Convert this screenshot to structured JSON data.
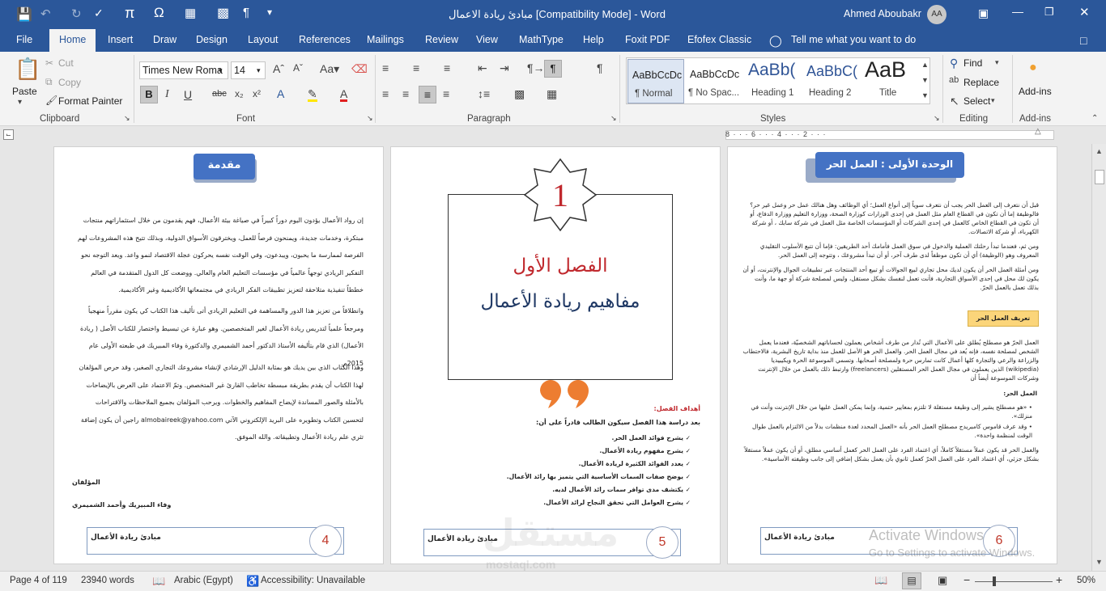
{
  "window": {
    "title": "مبادئ ريادة الاعمال [Compatibility Mode]  -  Word",
    "user": "Ahmed Aboubakr",
    "avatar": "AA"
  },
  "ribbon_tabs": [
    "File",
    "Home",
    "Insert",
    "Draw",
    "Design",
    "Layout",
    "References",
    "Mailings",
    "Review",
    "View",
    "MathType",
    "Help",
    "Foxit PDF",
    "Efofex Classic"
  ],
  "tell_me": "Tell me what you want to do",
  "clipboard": {
    "paste": "Paste",
    "cut": "Cut",
    "copy": "Copy",
    "format_painter": "Format Painter",
    "label": "Clipboard"
  },
  "font": {
    "name": "Times New Roma",
    "size": "14",
    "label": "Font"
  },
  "paragraph": {
    "label": "Paragraph"
  },
  "styles": {
    "items": [
      {
        "preview": "AaBbCcDc",
        "name": "¶ Normal"
      },
      {
        "preview": "AaBbCcDc",
        "name": "¶ No Spac..."
      },
      {
        "preview": "AaBb(",
        "name": "Heading 1"
      },
      {
        "preview": "AaBbC(",
        "name": "Heading 2"
      },
      {
        "preview": "AaB",
        "name": "Title"
      }
    ],
    "label": "Styles"
  },
  "editing": {
    "find": "Find",
    "replace": "Replace",
    "select": "Select",
    "label": "Editing"
  },
  "addins": {
    "button": "Add-ins",
    "label": "Add-ins"
  },
  "ruler": {
    "marks": "8 · · · 6 · · · 4 · · · 2 · · ·"
  },
  "pages": {
    "left": {
      "heading": "مقدمة",
      "paragraphs": [
        "إن رواد الأعمال يؤدون اليوم دوراً كبيراً في صياغة بيئة الأعمال، فهم يقدمون من خلال استثماراتهم منتجات مبتكرة، وخدمات جديدة، ويمنحون فرصاً للعمل، ويخترقون الأسواق الدولية، وبذلك تتيح هذه المشروعات لهم الفرصة لممارسة ما يحبون، ويبدعون، وفي الوقت نفسه يحركون عجلة الاقتصاد لنمو واعد. ويعد التوجه نحو التفكير الريادي توجهاً عالمياً في مؤسسات التعليم العام والعالي. ووضعت كل الدول المتقدمة في العالم خططاً تنفيذية متلاحقة لتعزيز تطبيقات الفكر الريادي في مجتمعاتها الأكاديمية وغير الأكاديمية.",
        "وانطلاقاً من تعزيز هذا الدور والمساهمة في التعليم الريادي أتى تأليف هذا الكتاب كي يكون مقرراً منهجياً ومرجعاً علمياً لتدريس ريادة الأعمال لغير المتخصصين. وهو عبارة عن تبسيط واختصار للكتاب الأصل ( ريادة الأعمال) الذي قام بتأليفه الأستاذ الدكتور أحمد الشميمري والدكتورة وفاء المبيريك في طبعته الأولى عام 2015م.",
        "وهذا الكتاب الذي بين يديك هو بمثابة الدليل الإرشادي لإنشاء مشروعك التجاري الصغير، وقد حرص المؤلفان لهذا الكتاب أن يقدم بطريقة مبسطة تخاطب القارئ غير المتخصص. وتمّ الاعتماد على العرض بالإيضاحات بالأمثلة والصور المساندة لإيضاح المفاهيم والخطوات. ويرحب المؤلفان بجميع الملاحظات والاقتراحات لتحسين الكتاب وتطويره على البريد الإلكتروني الآتي almobaireek@yahoo.com راجين أن يكون إضافة تثري علم ريادة الأعمال وتطبيقاته. والله الموفق."
      ],
      "authors_label": "المؤلفان",
      "authors": "وفاء المبيريك وأحمد الشميمري",
      "footer_title": "مبادئ ريادة الأعمال",
      "page_number": "4"
    },
    "middle": {
      "chapter_number": "1",
      "chapter_title": "الفصل الأول",
      "chapter_subtitle": "مفاهيم ريادة الأعمال",
      "goals_label": "أهداف الفصل:",
      "goals_intro": "بعد دراسة هذا الفصل سيكون الطالب قادراً على أن:",
      "goals": [
        "يشرح فوائد العمل الحر.",
        "يشرح مفهوم ريادة الأعمال.",
        "يعدد الفوائد الكثيرة لريادة الأعمال.",
        "يوضح صفات السمات الأساسية التي يتميز بها رائد الأعمال.",
        "يكتشف مدى توافر سمات رائد الأعمال لديه.",
        "يشرح العوامل التي تحقق النجاح لرائد الأعمال."
      ],
      "footer_title": "مبادئ ريادة الأعمال",
      "page_number": "5"
    },
    "right": {
      "heading": "الوحدة الأولى : العمل الحر",
      "paragraphs": [
        "قبل أن نتعرف إلى العمل الحر يجب أن نتعرف سوياً إلى أنواع العمل؛ أي الوظائف وهل هنالك عمل حر وعمل غير حر؟ فالوظيفة إما أن تكون في القطاع العام مثل العمل في إحدى الوزارات كوزارة الصحة، ووزارة التعليم ووزارة الدفاع، أو أن تكون في القطاع الخاص كالعمل في إحدى الشركات أو المؤسسات الخاصة مثل العمل في شركة سابك ، أو شركة الكهرباء، أو شركة الاتصالات.",
        "ومن ثم، فعندما تبدأ رحلتك العملية والدخول في سوق العمل فأمامك أحد الطريقين: فإما أن تتبع الأسلوب التقليدي المعروف وهو (الوظيفة) أي أن تكون موظفاً لدى طرف آخر، أو أن تبدأ مشروعك ، وتتوجه إلى العمل الحر.",
        "ومن أمثلة العمل الحر أن يكون لديك محل تجاري لبيع الجوالات أو تبيع أحد المنتجات عبر تطبيقات الجوال والإنترنت، أو أن يكون لك محل في إحدى الأسواق التجارية، فأنت تعمل لنفسك بشكل مستقل، وليس لمصلحة شركة أو جهة ما، وأنت بذلك تعمل بالعمل الحرّ."
      ],
      "box_label": "تعريف العمل الحر",
      "definition": "العمل الحرّ هو مصطلح يُطلق على الأعمال التي تُدار من طرف أشخاص يعملون لحساباتهم الشخصيّة، فعندما يعمل الشخص لمصلحة نفسه، فإنه يُعد في مجال العمل الحر. والعمل الحر هو الأصل للعمل منذ بداية تاريخ البشرية، فالاحتطاب والزراعة والرعي والتجارة كلها أعمال كانت تمارس حرة ولمصلحة أصحابها. وتسمي الموسوعة الحرة ويكيبيديا (wikipedia) الذين يعملون في مجال العمل الحر المستقلين (freelancers) وارتبط ذلك بالعمل من خلال الإنترنت وشركات الموسوعة أيضاً أن",
      "subhead": "العمل الحر:",
      "bullets": [
        "«هو مصطلح يشير إلى وظيفة مستقلة لا تلتزم بمعايير حتمية، وإنما يمكن العمل عليها من خلال الإنترنت وأنت في منزلك».",
        "وقد عرف قاموس كامبريدج مصطلح العمل الحر بأنه «العمل المحدد لعدة منظمات بدلاً من الالتزام بالعمل طوال الوقت لمنظمة واحدة»."
      ],
      "closing": "والعمل الحر قد يكون عملاً مستقلاً كاملاً، أي اعتماد الفرد على العمل الحر كعمل أساسي مطلق، أو أن يكون عملاً مستقلاً بشكل جزئي، أي اعتماد الفرد على العمل الحرّ كعمل ثانوي بأن يعمل بشكل إضافي إلى جانب وظيفته الأساسية».",
      "footer_title": "مبادئ ريادة الأعمال",
      "page_number": "6"
    }
  },
  "watermark": {
    "activate": "Activate Windows",
    "goto": "Go to Settings to activate Windows.",
    "brand": "مستقل",
    "brand_latin": "mostaql.com"
  },
  "status": {
    "page": "Page 4 of 119",
    "words": "23940 words",
    "language": "Arabic (Egypt)",
    "accessibility": "Accessibility: Unavailable",
    "zoom": "50%"
  },
  "colors": {
    "word_blue": "#2b579a",
    "heading_box": "#4472c4",
    "chapter_red": "#c0282d",
    "chapter_blue": "#1f3864",
    "quote_orange": "#ed7d31",
    "definition_box": "#fbd57a"
  }
}
